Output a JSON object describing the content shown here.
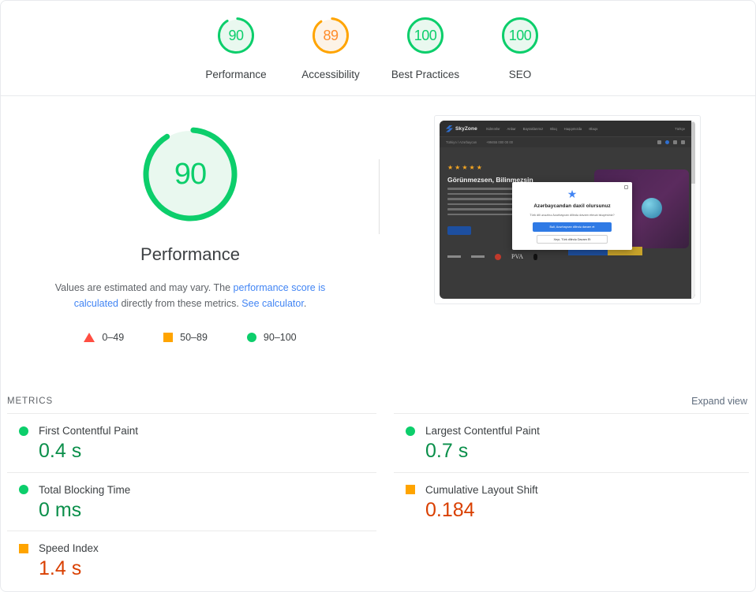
{
  "scores": [
    {
      "name": "performance",
      "value": "90",
      "label": "Performance",
      "state": "pass",
      "arc_pct": 90
    },
    {
      "name": "accessibility",
      "value": "89",
      "label": "Accessibility",
      "state": "avg",
      "arc_pct": 89
    },
    {
      "name": "best-practices",
      "value": "100",
      "label": "Best Practices",
      "state": "pass",
      "arc_pct": 100
    },
    {
      "name": "seo",
      "value": "100",
      "label": "SEO",
      "state": "pass",
      "arc_pct": 100
    }
  ],
  "hero": {
    "gauge_value": "90",
    "title": "Performance",
    "desc_part1": "Values are estimated and may vary. The ",
    "desc_link1": "performance score is calculated",
    "desc_part2": " directly from these metrics. ",
    "desc_link2": "See calculator",
    "desc_part3": "."
  },
  "legend": [
    {
      "shape": "triangle",
      "label": "0–49",
      "color": "#ff4e42"
    },
    {
      "shape": "square",
      "label": "50–89",
      "color": "#ffa400"
    },
    {
      "shape": "circle",
      "label": "90–100",
      "color": "#0cce6b"
    }
  ],
  "screenshot": {
    "brand": "SkyZone",
    "nav_links": [
      "Xidmətlər",
      "Anbar",
      "Bayraklarımız",
      "Bloq",
      "Haqqımızda",
      "Əlaqə"
    ],
    "nav_right": "Türkçe",
    "subnav_location": "Türkiyə / Azərbaycan",
    "subnav_phone": "+99455 000 00 00",
    "hero_heading": "Görünmezsen, Bilinmezsin",
    "modal": {
      "title": "Azərbaycandan daxil olursunuz",
      "subtitle": "Türk dili əvəzinə Azərbaycan dilində davam etmək istəyirsiniz?",
      "primary_button": "Bəli, Azərbaycan dilində davam et",
      "secondary_button": "Xeyr, Türk dilində Davam Et"
    }
  },
  "metrics_section": {
    "title": "METRICS",
    "expand_label": "Expand view"
  },
  "metrics": [
    {
      "name": "first-contentful-paint",
      "label": "First Contentful Paint",
      "value": "0.4 s",
      "state": "pass"
    },
    {
      "name": "largest-contentful-paint",
      "label": "Largest Contentful Paint",
      "value": "0.7 s",
      "state": "pass"
    },
    {
      "name": "total-blocking-time",
      "label": "Total Blocking Time",
      "value": "0 ms",
      "state": "pass"
    },
    {
      "name": "cumulative-layout-shift",
      "label": "Cumulative Layout Shift",
      "value": "0.184",
      "state": "avg"
    },
    {
      "name": "speed-index",
      "label": "Speed Index",
      "value": "1.4 s",
      "state": "avg"
    }
  ],
  "colors": {
    "pass": "#0cce6b",
    "average": "#ffa400",
    "fail": "#ff4e42",
    "link": "#4285f4"
  }
}
